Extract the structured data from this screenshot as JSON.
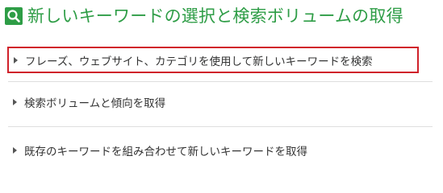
{
  "header": {
    "icon": "search-icon",
    "title": "新しいキーワードの選択と検索ボリュームの取得",
    "accent_color": "#2e9d46"
  },
  "options": [
    {
      "label": "フレーズ、ウェブサイト、カテゴリを使用して新しいキーワードを検索",
      "highlighted": true,
      "icon": "caret-right-icon"
    },
    {
      "label": "検索ボリュームと傾向を取得",
      "highlighted": false,
      "icon": "caret-right-icon"
    },
    {
      "label": "既存のキーワードを組み合わせて新しいキーワードを取得",
      "highlighted": false,
      "icon": "caret-right-icon"
    }
  ],
  "highlight_color": "#d0212a"
}
